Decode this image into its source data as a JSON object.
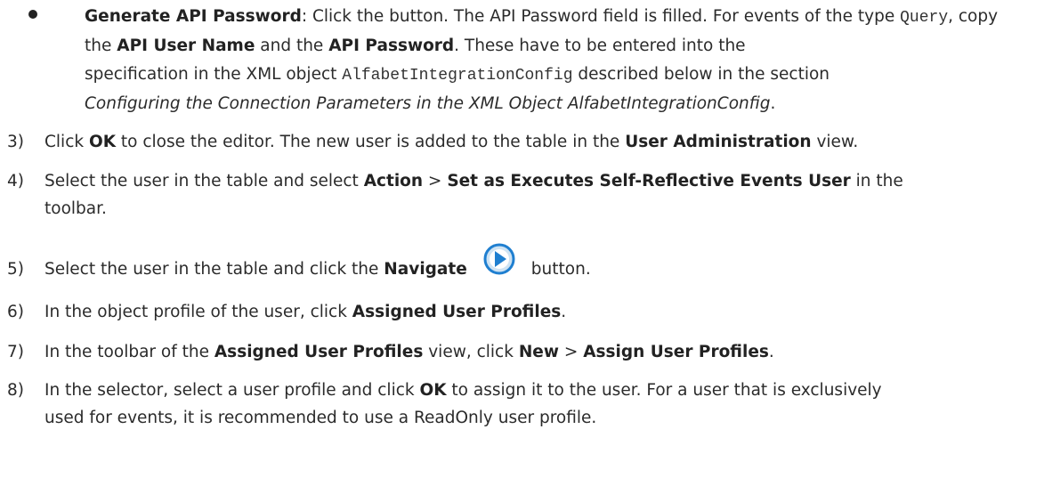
{
  "bullet": {
    "term": "Generate API Password",
    "t1": ": Click the button. The API Password field is filled. For events of the type",
    "code1": "Query",
    "t2": ", copy the ",
    "api_user_name": "API User Name",
    "t3": " and the ",
    "api_password": "API Password",
    "t4": ". These have to be entered into the",
    "t5": "specification in the XML object ",
    "code2": "AlfabetIntegrationConfig",
    "t6": " described below in the section",
    "italic": "Configuring the Connection Parameters in the XML Object AlfabetIntegrationConfig",
    "t7": "."
  },
  "steps": {
    "s3": {
      "num": "3)",
      "a": "Click ",
      "ok": "OK",
      "b": " to close the editor. The new user is added to the table in the ",
      "view": "User Administration",
      "c": " view."
    },
    "s4": {
      "num": "4)",
      "a": "Select the user in the table and select ",
      "action": "Action",
      "sep": " > ",
      "set": "Set as Executes Self-Reflective Events User",
      "b": " in the",
      "c": "toolbar."
    },
    "s5": {
      "num": "5)",
      "a": "Select the user in the table and click the ",
      "navigate": "Navigate",
      "b": "button.",
      "icon": "navigate-arrow-icon"
    },
    "s6": {
      "num": "6)",
      "a": "In the object profile of the user, click ",
      "profiles": "Assigned User Profiles",
      "b": "."
    },
    "s7": {
      "num": "7)",
      "a": "In the toolbar of the ",
      "profiles": "Assigned User Profiles",
      "b": " view, click ",
      "new": "New",
      "sep": " > ",
      "assign": "Assign User Profiles",
      "c": "."
    },
    "s8": {
      "num": "8)",
      "a": "In the selector, select a user profile and click ",
      "ok": "OK",
      "b": " to assign it to the user. For a user that is exclusively",
      "c": "used for events, it is recommended to use a ReadOnly user profile."
    }
  },
  "colors": {
    "icon_blue": "#1f7fd0",
    "icon_light": "#cfe3f3"
  }
}
